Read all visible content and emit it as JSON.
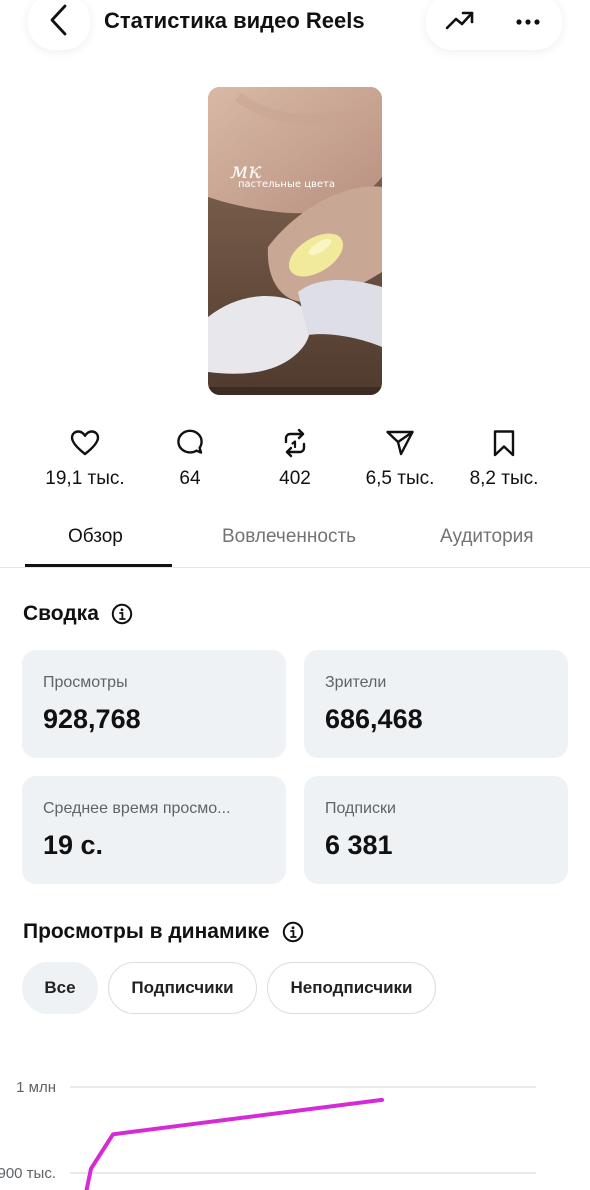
{
  "header": {
    "title": "Статистика видео Reels",
    "back_icon": "chevron-left-icon",
    "trend_icon": "trending-up-icon",
    "more_icon": "more-horizontal-icon"
  },
  "thumbnail": {
    "script_text": "мк",
    "caption": "пастельные цвета"
  },
  "metrics": [
    {
      "icon": "heart-icon",
      "value": "19,1 тыс."
    },
    {
      "icon": "comment-icon",
      "value": "64"
    },
    {
      "icon": "repost-icon",
      "value": "402"
    },
    {
      "icon": "share-icon",
      "value": "6,5 тыс."
    },
    {
      "icon": "bookmark-icon",
      "value": "8,2 тыс."
    }
  ],
  "tabs": [
    "Обзор",
    "Вовлеченность",
    "Аудитория"
  ],
  "active_tab": "Обзор",
  "summary": {
    "title": "Сводка",
    "cards": [
      {
        "label": "Просмотры",
        "value": "928,768"
      },
      {
        "label": "Зрители",
        "value": "686,468"
      },
      {
        "label": "Среднее время просмо...",
        "value": "19 с."
      },
      {
        "label": "Подписки",
        "value": "6 381"
      }
    ]
  },
  "dynamics": {
    "title": "Просмотры в динамике",
    "chips": [
      "Все",
      "Подписчики",
      "Неподписчики"
    ],
    "selected_chip": "Все"
  },
  "chart_data": {
    "type": "line",
    "y_ticks": [
      "1 млн",
      "900 тыс."
    ],
    "y_tick_values": [
      1000000,
      900000
    ],
    "series": [
      {
        "color": "#d62ad6",
        "values_visible": [
          855000,
          905000,
          945000,
          955000,
          985000
        ]
      }
    ],
    "note_visible": "chart is cropped at the bottom of the screen"
  },
  "colors": {
    "accent_line": "#d62ad6",
    "card_bg": "#eff2f5",
    "muted_text": "#737373"
  }
}
